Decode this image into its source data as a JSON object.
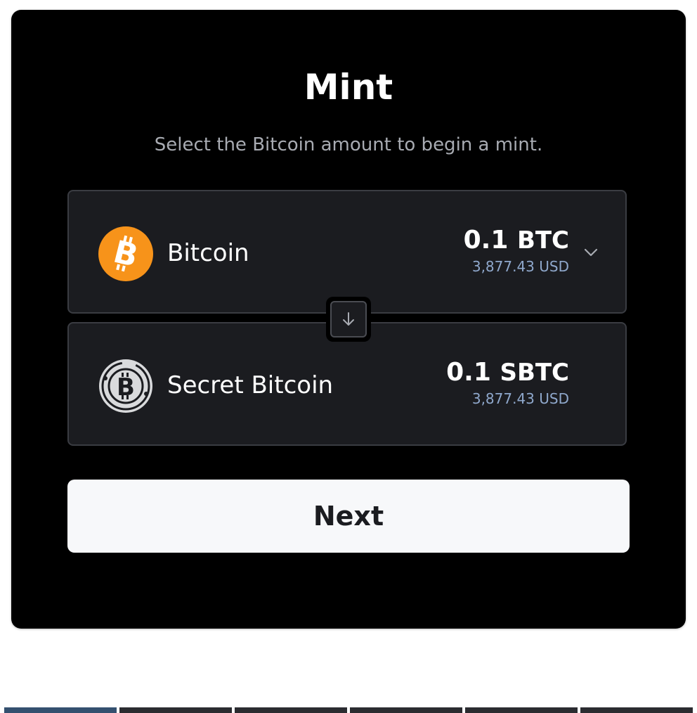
{
  "mint": {
    "title": "Mint",
    "subtitle": "Select the Bitcoin amount to begin a mint."
  },
  "from_asset": {
    "name": "Bitcoin",
    "amount": "0.1",
    "unit": "BTC",
    "usd_value": "3,877.43 USD",
    "icon": "bitcoin-icon",
    "icon_color": "#f7931a"
  },
  "to_asset": {
    "name": "Secret Bitcoin",
    "amount": "0.1",
    "unit": "SBTC",
    "usd_value": "3,877.43 USD",
    "icon": "secret-bitcoin-icon",
    "icon_color": "#d9dadc"
  },
  "swap": {
    "icon": "arrow-down-icon"
  },
  "next_button": {
    "label": "Next"
  },
  "colors": {
    "card_bg": "#000000",
    "box_bg": "#1b1c20",
    "usd_text": "#8fa8cc",
    "button_bg": "#f7f8fa"
  }
}
